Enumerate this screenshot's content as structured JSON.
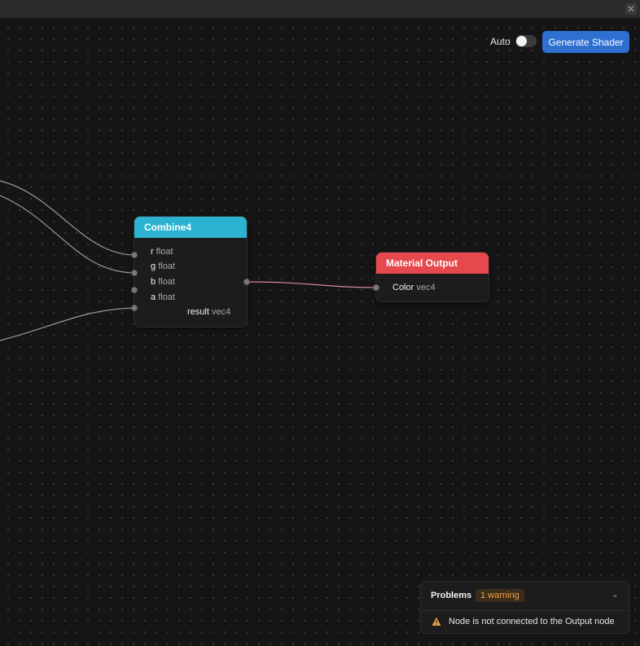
{
  "window": {
    "close_label": "✕"
  },
  "toolbar": {
    "auto_label": "Auto",
    "auto_enabled": false,
    "generate_label": "Generate Shader"
  },
  "nodes": {
    "combine4": {
      "title": "Combine4",
      "header_color": "#2bb3d1",
      "inputs": [
        {
          "name": "r",
          "type": "float"
        },
        {
          "name": "g",
          "type": "float"
        },
        {
          "name": "b",
          "type": "float"
        },
        {
          "name": "a",
          "type": "float"
        }
      ],
      "output": {
        "name": "result",
        "type": "vec4"
      }
    },
    "material_output": {
      "title": "Material Output",
      "header_color": "#e5484d",
      "inputs": [
        {
          "name": "Color",
          "type": "vec4"
        }
      ]
    }
  },
  "problems": {
    "title": "Problems",
    "badge": "1 warning",
    "chevron": "⌄",
    "items": [
      {
        "text": "Node is not connected to the Output node"
      }
    ]
  }
}
